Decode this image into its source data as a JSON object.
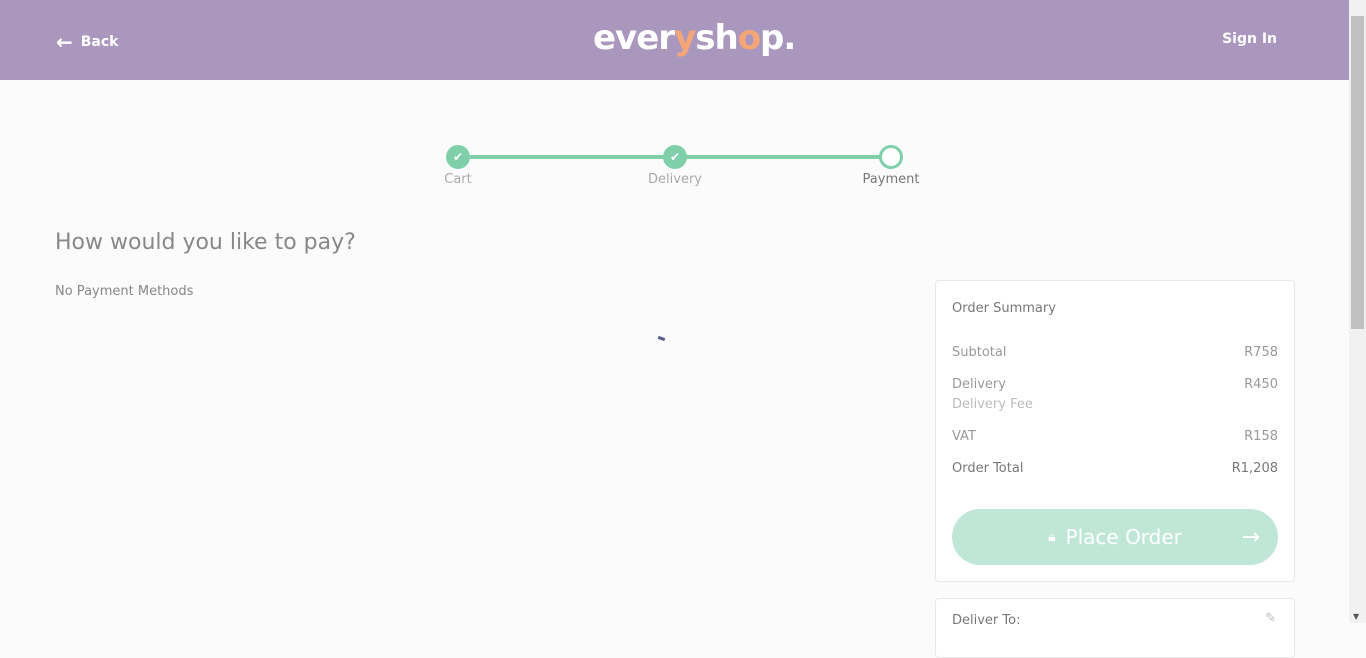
{
  "header": {
    "back_label": "Back",
    "logo": "everyshop.",
    "sign_in": "Sign In"
  },
  "steps": [
    {
      "label": "Cart",
      "state": "done"
    },
    {
      "label": "Delivery",
      "state": "done"
    },
    {
      "label": "Payment",
      "state": "current"
    }
  ],
  "payment": {
    "heading": "How would you like to pay?",
    "empty": "No Payment Methods"
  },
  "summary": {
    "title": "Order Summary",
    "subtotal_label": "Subtotal",
    "subtotal": "R758",
    "delivery_label": "Delivery",
    "delivery": "R450",
    "delivery_note": "Delivery Fee",
    "vat_label": "VAT",
    "vat": "R158",
    "total_label": "Order Total",
    "total": "R1,208",
    "place_order": "Place Order"
  },
  "deliver": {
    "title": "Deliver To:"
  },
  "colors": {
    "header": "#a997bd",
    "accent": "#7ecfaa"
  }
}
